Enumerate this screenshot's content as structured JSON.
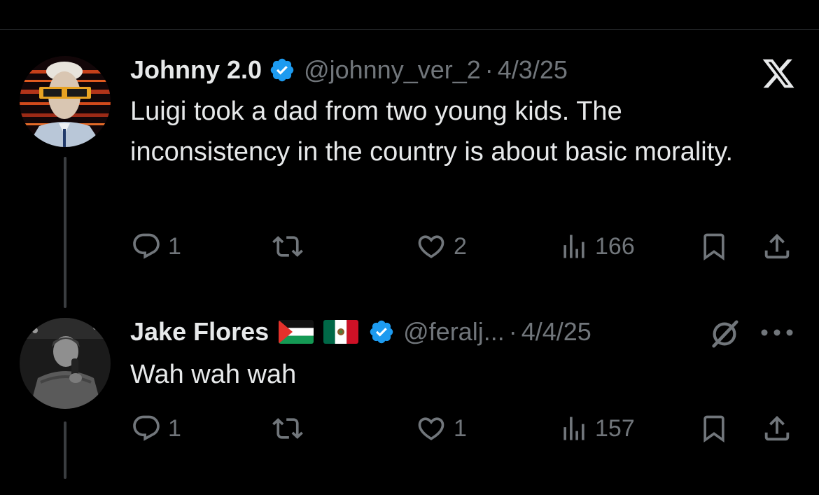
{
  "tweets": [
    {
      "display_name": "Johnny 2.0",
      "handle": "@johnny_ver_2",
      "separator": "·",
      "date": "4/3/25",
      "text": "Luigi took a dad from two young kids. The inconsistency in the country is about basic morality.",
      "verified": true,
      "stats": {
        "replies": "1",
        "retweets": "",
        "likes": "2",
        "views": "166"
      }
    },
    {
      "display_name": "Jake Flores",
      "handle": "@feralj...",
      "separator": "·",
      "date": "4/4/25",
      "text": "Wah wah wah",
      "verified": true,
      "flags": [
        "palestine-flag",
        "mexico-flag"
      ],
      "stats": {
        "replies": "1",
        "retweets": "",
        "likes": "1",
        "views": "157"
      }
    }
  ],
  "icons": {
    "reply": "reply-icon",
    "retweet": "retweet-icon",
    "like": "heart-icon",
    "views": "views-icon",
    "bookmark": "bookmark-icon",
    "share": "share-icon",
    "x_logo": "x-logo-icon",
    "grok": "grok-icon",
    "more": "more-icon"
  },
  "colors": {
    "background": "#000000",
    "text": "#e7e9ea",
    "secondary": "#71767b",
    "verified": "#1d9bf0",
    "thread_line": "#3a3d40"
  }
}
